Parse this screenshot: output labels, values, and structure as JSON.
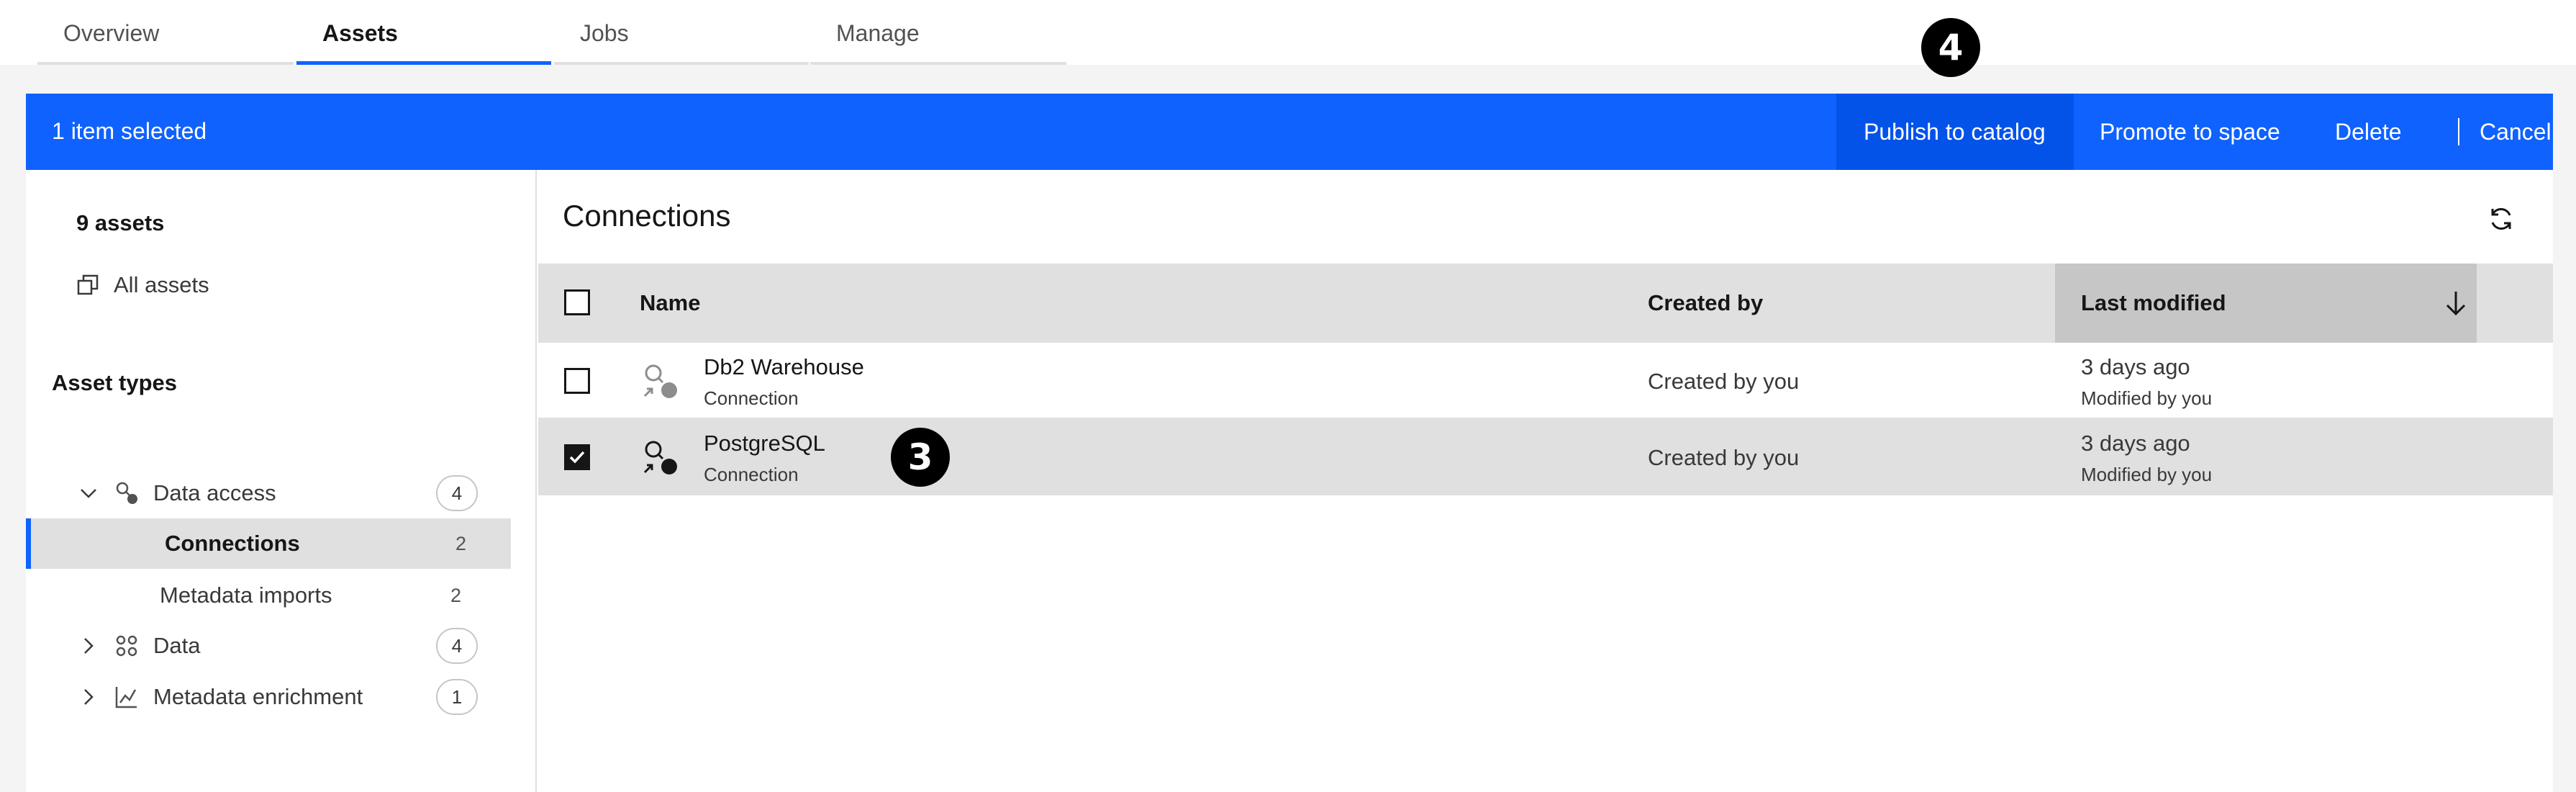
{
  "tabs": [
    {
      "label": "Overview"
    },
    {
      "label": "Assets"
    },
    {
      "label": "Jobs"
    },
    {
      "label": "Manage"
    }
  ],
  "callouts": {
    "publish": "4",
    "row": "3"
  },
  "action_bar": {
    "selected_text": "1 item selected",
    "publish": "Publish to catalog",
    "promote": "Promote to space",
    "delete": "Delete",
    "cancel": "Cancel"
  },
  "sidebar": {
    "count": "9 assets",
    "all_assets": "All assets",
    "types_title": "Asset types",
    "items": [
      {
        "label": "Data access",
        "count": "4"
      },
      {
        "label": "Connections",
        "count": "2"
      },
      {
        "label": "Metadata imports",
        "count": "2"
      },
      {
        "label": "Data",
        "count": "4"
      },
      {
        "label": "Metadata enrichment",
        "count": "1"
      }
    ]
  },
  "content": {
    "title": "Connections",
    "columns": {
      "name": "Name",
      "created_by": "Created by",
      "last_modified": "Last modified"
    },
    "rows": [
      {
        "name": "Db2 Warehouse",
        "type": "Connection",
        "created_by": "Created by you",
        "modified": "3 days ago",
        "modified_by": "Modified by you",
        "checked": false
      },
      {
        "name": "PostgreSQL",
        "type": "Connection",
        "created_by": "Created by you",
        "modified": "3 days ago",
        "modified_by": "Modified by you",
        "checked": true
      }
    ]
  },
  "colors": {
    "accent": "#0f62fe",
    "accent_pressed": "#0353e9",
    "selected_row": "#e0e0e0"
  },
  "icons": [
    "copy-icon",
    "chevron-down-icon",
    "chevron-right-icon",
    "connection-icon",
    "data-icon",
    "enrichment-icon",
    "refresh-icon",
    "sort-down-icon",
    "checkmark-icon"
  ]
}
